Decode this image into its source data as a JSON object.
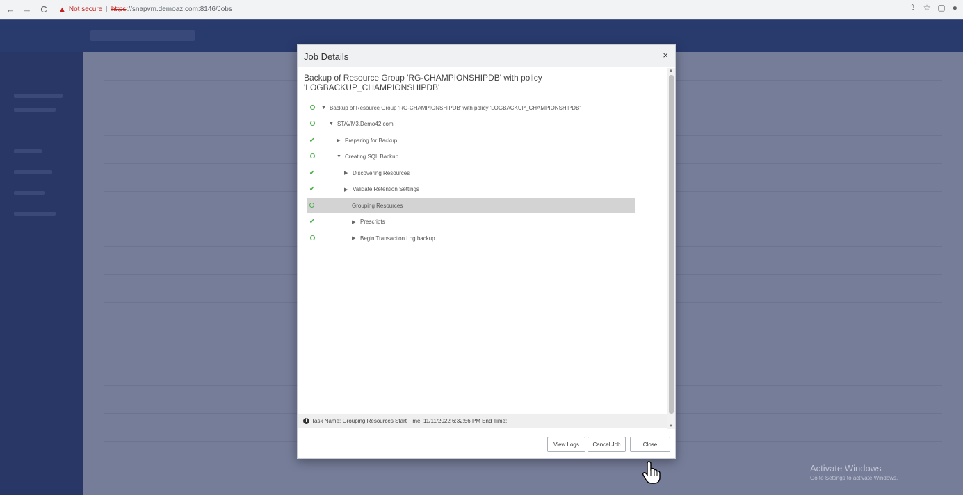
{
  "browser": {
    "back_icon": "←",
    "forward_icon": "→",
    "reload_icon": "C",
    "warning_icon": "▲",
    "not_secure": "Not secure",
    "separator": "|",
    "url_https": "https",
    "url_rest": "://snapvm.demoaz.com:8146/Jobs",
    "share_icon": "⇪",
    "star_icon": "☆",
    "window_icon": "▢",
    "profile_icon": "●"
  },
  "modal": {
    "title": "Job Details",
    "close_icon": "×",
    "job_title": "Backup of Resource Group 'RG-CHAMPIONSHIPDB' with policy 'LOGBACKUP_CHAMPIONSHIPDB'",
    "tree": [
      {
        "status": "running",
        "caret": "▼",
        "indent": 0,
        "label": "Backup of Resource Group 'RG-CHAMPIONSHIPDB' with policy 'LOGBACKUP_CHAMPIONSHIPDB'"
      },
      {
        "status": "running",
        "caret": "▼",
        "indent": 1,
        "label": "STAVM3.Demo42.com"
      },
      {
        "status": "done",
        "caret": "▶",
        "indent": 2,
        "label": "Preparing for Backup"
      },
      {
        "status": "running",
        "caret": "▼",
        "indent": 2,
        "label": "Creating SQL Backup"
      },
      {
        "status": "done",
        "caret": "▶",
        "indent": 3,
        "label": "Discovering Resources"
      },
      {
        "status": "done",
        "caret": "▶",
        "indent": 3,
        "label": "Validate Retention Settings"
      },
      {
        "status": "running",
        "caret": "",
        "indent": 3,
        "label": "Grouping Resources",
        "selected": true
      },
      {
        "status": "done",
        "caret": "▶",
        "indent": 4,
        "label": "Prescripts"
      },
      {
        "status": "running",
        "caret": "▶",
        "indent": 4,
        "label": "Begin Transaction Log backup"
      }
    ],
    "info_icon": "i",
    "task_info": "Task Name: Grouping Resources Start Time: 11/11/2022 6:32:56 PM End Time:",
    "btn_view_logs": "View Logs",
    "btn_cancel_job": "Cancel Job",
    "btn_close": "Close"
  },
  "watermark": {
    "line1": "Activate Windows",
    "line2": "Go to Settings to activate Windows."
  }
}
